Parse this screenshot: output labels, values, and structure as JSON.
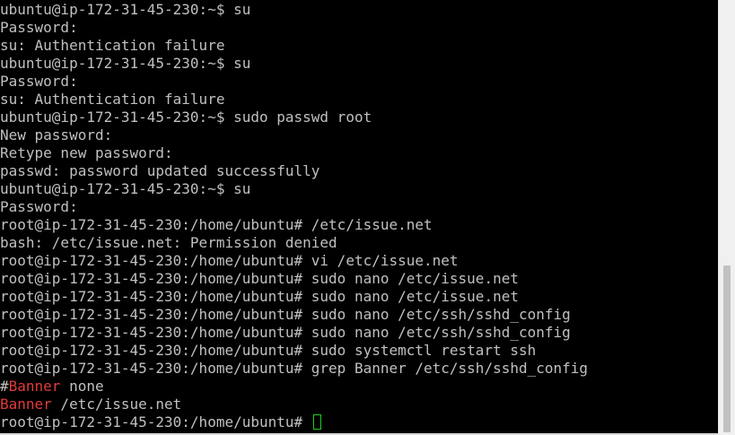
{
  "terminal": {
    "lines": [
      "ubuntu@ip-172-31-45-230:~$ su",
      "Password:",
      "su: Authentication failure",
      "ubuntu@ip-172-31-45-230:~$ su",
      "Password:",
      "su: Authentication failure",
      "ubuntu@ip-172-31-45-230:~$ sudo passwd root",
      "New password:",
      "Retype new password:",
      "passwd: password updated successfully",
      "ubuntu@ip-172-31-45-230:~$ su",
      "Password:",
      "root@ip-172-31-45-230:/home/ubuntu# /etc/issue.net",
      "bash: /etc/issue.net: Permission denied",
      "root@ip-172-31-45-230:/home/ubuntu# vi /etc/issue.net",
      "root@ip-172-31-45-230:/home/ubuntu# sudo nano /etc/issue.net",
      "root@ip-172-31-45-230:/home/ubuntu# sudo nano /etc/issue.net",
      "root@ip-172-31-45-230:/home/ubuntu# sudo nano /etc/ssh/sshd_config",
      "root@ip-172-31-45-230:/home/ubuntu# sudo nano /etc/ssh/sshd_config",
      "root@ip-172-31-45-230:/home/ubuntu# sudo systemctl restart ssh",
      "root@ip-172-31-45-230:/home/ubuntu# grep Banner /etc/ssh/sshd_config"
    ],
    "grep_results": [
      {
        "prefix": "#",
        "match": "Banner",
        "rest": " none"
      },
      {
        "prefix": "",
        "match": "Banner",
        "rest": " /etc/issue.net"
      }
    ],
    "current_prompt": "root@ip-172-31-45-230:/home/ubuntu# "
  },
  "colors": {
    "background": "#000000",
    "text": "#c0c0c0",
    "grep_match": "#e23b3b",
    "cursor": "#19d119"
  }
}
